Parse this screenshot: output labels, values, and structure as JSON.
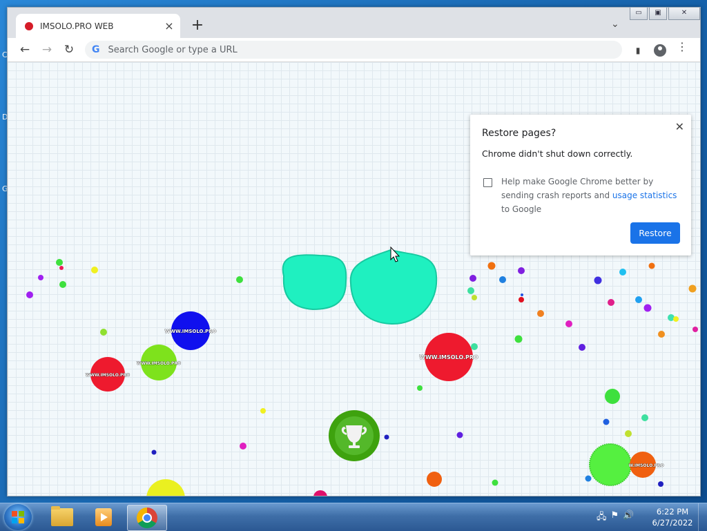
{
  "desktop": {
    "glyphs": [
      "C",
      "D",
      "G"
    ]
  },
  "browser": {
    "tab": {
      "title": "IMSOLO.PRO WEB",
      "favicon_color": "#d51c28"
    },
    "new_tab_label": "+",
    "tab_search_icon": "chevron-down-icon",
    "window_controls": {
      "minimize": "▭",
      "maximize": "▣",
      "close": "✕"
    },
    "omnibox": {
      "placeholder": "Search Google or type a URL",
      "icon_text": "G"
    },
    "icons": {
      "back": "←",
      "forward": "→",
      "reload": "↻",
      "side_panel": "▮",
      "menu": "⋮"
    }
  },
  "restore_popup": {
    "title": "Restore pages?",
    "close_label": "✕",
    "message": "Chrome didn't shut down correctly.",
    "help_text_before": "Help make Google Chrome better by sending crash reports and ",
    "help_link": "usage statistics",
    "help_text_after": " to Google",
    "restore_label": "Restore",
    "accent_color": "#1a73e8"
  },
  "game": {
    "cell_label": "WWW.IMSOLO.PRO",
    "cell_label_short": "W.IMSOLO.PRO",
    "trophy_icon": "trophy-icon",
    "player_color": "#1ff0c0",
    "cells": [
      {
        "name": "blue-cell",
        "color": "#1010ee",
        "label": true
      },
      {
        "name": "lime-cell",
        "color": "#7ee21c",
        "label": true
      },
      {
        "name": "red-cell-left",
        "color": "#ee1a2e",
        "label": true
      },
      {
        "name": "red-cell-center",
        "color": "#ee1a2e",
        "label": true
      },
      {
        "name": "green-cell",
        "color": "#55f040",
        "label": false
      },
      {
        "name": "orange-cell",
        "color": "#f06010",
        "label": true
      }
    ]
  },
  "taskbar": {
    "items": [
      "start-button",
      "explorer",
      "media-player",
      "chrome"
    ],
    "clock": {
      "time": "6:22 PM",
      "date": "6/27/2022"
    },
    "tray_icons": [
      "network-icon",
      "flag-icon",
      "volume-icon"
    ]
  }
}
